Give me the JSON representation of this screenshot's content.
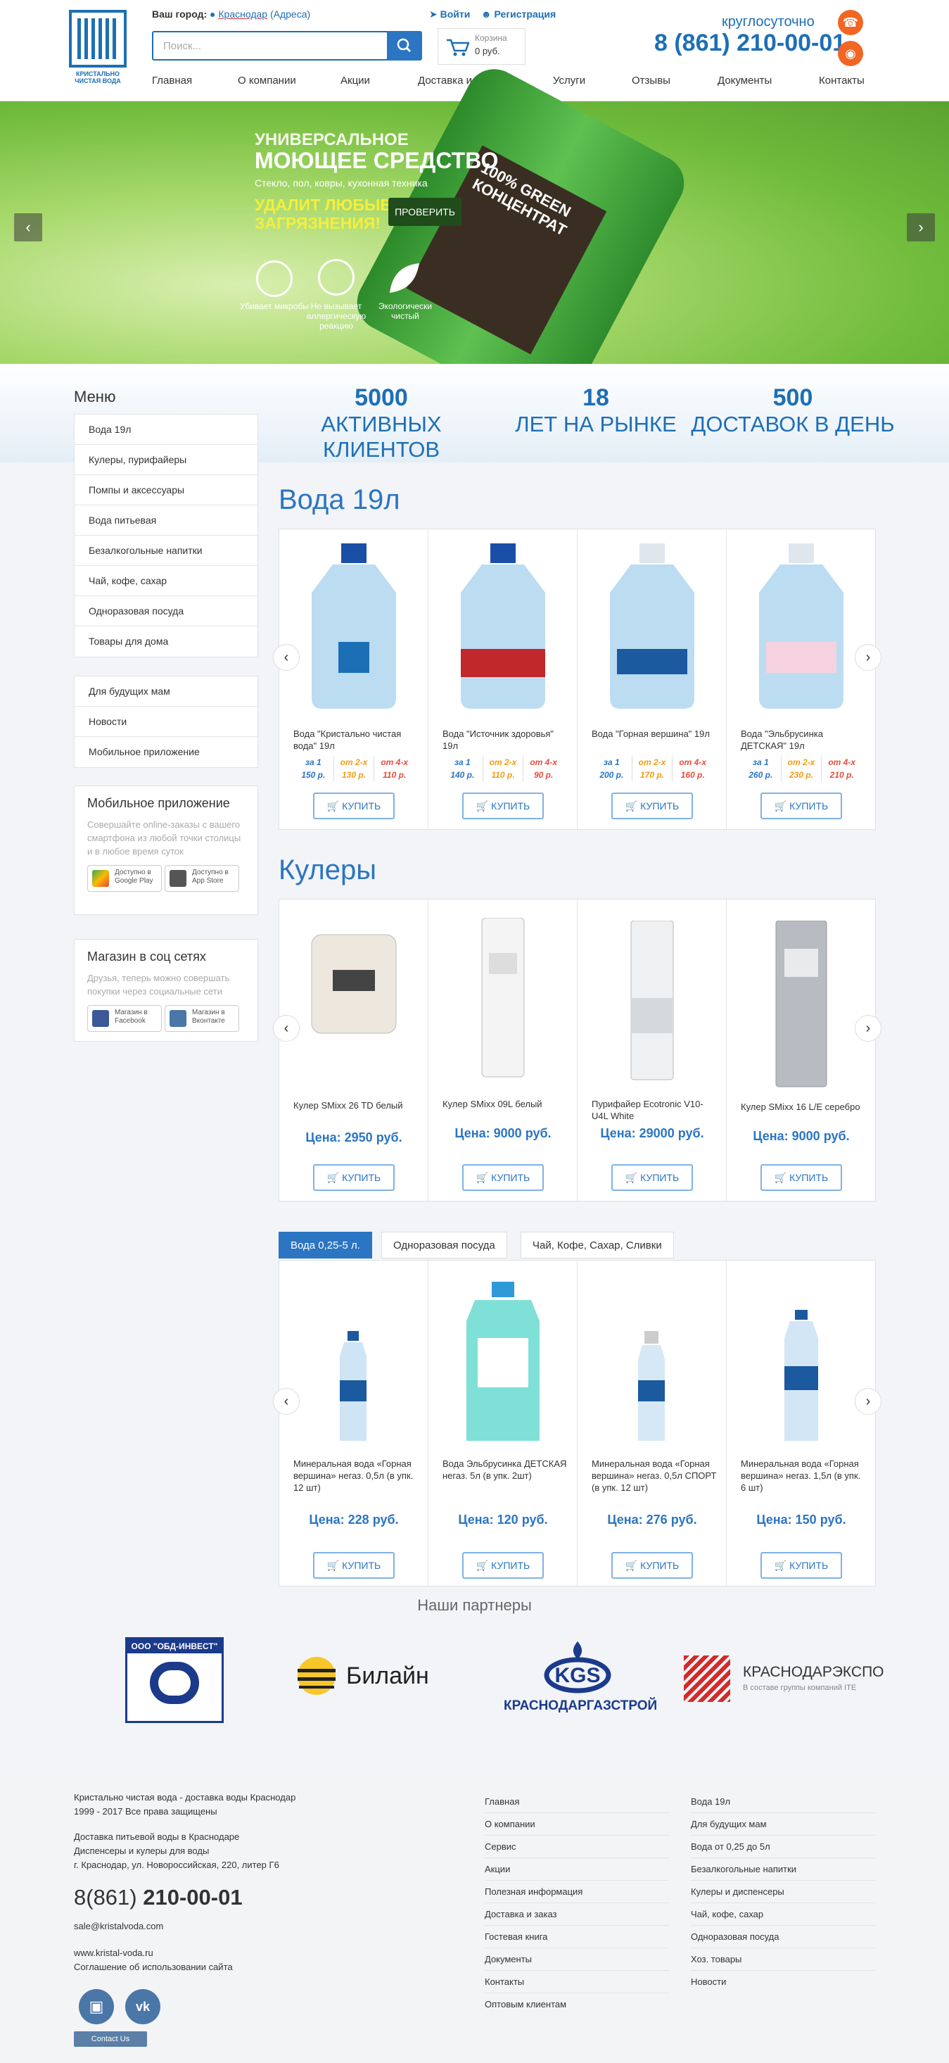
{
  "header": {
    "city_label": "Ваш город:",
    "city": "Краснодар",
    "city_addr": "(Адреса)",
    "search_placeholder": "Поиск...",
    "login": "Войти",
    "register": "Регистрация",
    "cart_title": "Корзина",
    "cart_sum": "0 руб.",
    "around_clock": "круглосуточно",
    "phone": "8 (861) 210-00-01",
    "logo_text": "КРИСТАЛЬНО ЧИСТАЯ ВОДА",
    "nav": [
      "Главная",
      "О компании",
      "Акции",
      "Доставка и оплата",
      "Услуги",
      "Отзывы",
      "Документы",
      "Контакты"
    ]
  },
  "banner": {
    "small": "УНИВЕРСАЛЬНОЕ",
    "big": "МОЮЩЕЕ СРЕДСТВО",
    "sub": "Стекло, пол, ковры, кухонная техника",
    "yellow": "УДАЛИТ ЛЮБЫЕ ЗАГРЯЗНЕНИЯ!",
    "button": "ПРОВЕРИТЬ",
    "features": [
      "Убивает микробы",
      "Не вызывает аллергическую реакцию",
      "Экологически чистый"
    ],
    "bottle_text": "100% GREEN КОНЦЕНТРАТ"
  },
  "stats": [
    {
      "num": "5000",
      "label": "АКТИВНЫХ КЛИЕНТОВ"
    },
    {
      "num": "18",
      "label": "ЛЕТ НА РЫНКЕ"
    },
    {
      "num": "500",
      "label": "ДОСТАВОК В ДЕНЬ"
    }
  ],
  "menu": {
    "title": "Меню",
    "items": [
      "Вода 19л",
      "Кулеры, пурифайеры",
      "Помпы и аксессуары",
      "Вода питьевая",
      "Безалкогольные напитки",
      "Чай, кофе, сахар",
      "Одноразовая посуда",
      "Товары для дома"
    ],
    "items2": [
      "Для будущих мам",
      "Новости",
      "Мобильное приложение"
    ]
  },
  "mobile": {
    "title": "Мобильное приложение",
    "text": "Совершайте online-заказы с вашего смартфона из любой точки столицы и в любое время суток",
    "gp": "Доступно в Google Play",
    "as": "Доступно в App Store"
  },
  "social": {
    "title": "Магазин в соц сетях",
    "text": "Друзья, теперь можно совершать покупки через социальные сети",
    "fb": "Магазин в Facebook",
    "vk": "Магазин в Вконтакте"
  },
  "water": {
    "title": "Вода 19л",
    "buy": "КУПИТЬ",
    "products": [
      {
        "name": "Вода \"Кристально чистая вода\" 19л",
        "t": [
          "за 1",
          "от 2-х",
          "от 4-х"
        ],
        "p": [
          "150 р.",
          "130 р.",
          "110 р."
        ]
      },
      {
        "name": "Вода \"Источник здоровья\" 19л",
        "t": [
          "за 1",
          "от 2-х",
          "от 4-х"
        ],
        "p": [
          "140 р.",
          "110 р.",
          "90 р."
        ]
      },
      {
        "name": "Вода \"Горная вершина\" 19л",
        "t": [
          "за 1",
          "от 2-х",
          "от 4-х"
        ],
        "p": [
          "200 р.",
          "170 р.",
          "160 р."
        ]
      },
      {
        "name": "Вода \"Эльбрусинка ДЕТСКАЯ\" 19л",
        "t": [
          "за 1",
          "от 2-х",
          "от 4-х"
        ],
        "p": [
          "260 р.",
          "230 р.",
          "210 р."
        ]
      }
    ]
  },
  "coolers": {
    "title": "Кулеры",
    "buy": "КУПИТЬ",
    "products": [
      {
        "name": "Кулер SMixx 26 TD белый",
        "price": "Цена: 2950 руб."
      },
      {
        "name": "Кулер SMixx 09L белый",
        "price": "Цена: 9000 руб."
      },
      {
        "name": "Пурифайер Ecotronic V10-U4L White",
        "price": "Цена: 29000 руб."
      },
      {
        "name": "Кулер SMixx 16 L/E серебро",
        "price": "Цена: 9000 руб."
      }
    ]
  },
  "tabs": [
    "Вода 0,25-5 л.",
    "Одноразовая посуда",
    "Чай, Кофе, Сахар, Сливки"
  ],
  "small_water": {
    "buy": "КУПИТЬ",
    "products": [
      {
        "name": "Минеральная вода «Горная вершина» негаз. 0,5л (в упк. 12 шт)",
        "price": "Цена: 228 руб."
      },
      {
        "name": "Вода Эльбрусинка ДЕТСКАЯ негаз. 5л (в упк. 2шт)",
        "price": "Цена: 120 руб."
      },
      {
        "name": "Минеральная вода «Горная вершина» негаз. 0,5л СПОРТ (в упк. 12 шт)",
        "price": "Цена: 276 руб."
      },
      {
        "name": "Минеральная вода «Горная вершина» негаз. 1,5л (в упк. 6 шт)",
        "price": "Цена: 150 руб."
      }
    ]
  },
  "partners": {
    "title": "Наши партнеры",
    "names": [
      "ООО \"ОБД-ИНВЕСТ\"",
      "Билайн",
      "КРАСНОДАРГАЗСТРОЙ",
      "КРАСНОДАРЭКСПО",
      "В составе группы компаний ITE"
    ]
  },
  "footer": {
    "l1": "Кристально чистая вода - доставка воды Краснодар",
    "l2": "1999 - 2017 Все права защищены",
    "l3": "Доставка питьевой воды в Краснодаре",
    "l4": "Диспенсеры и кулеры для воды",
    "l5": "г. Краснодар, ул. Новороссийская, 220, литер Г6",
    "phone_prefix": "8(861) ",
    "phone_main": "210-00-01",
    "email": "sale@kristalvoda.com",
    "site": "www.kristal-voda.ru",
    "terms": "Соглашение об использовании сайта",
    "vk_btn": "Contact Us",
    "col1": [
      "Главная",
      "О компании",
      "Сервис",
      "Акции",
      "Полезная информация",
      "Доставка и заказ",
      "Гостевая книга",
      "Документы",
      "Контакты",
      "Оптовым клиентам"
    ],
    "col2": [
      "Вода 19л",
      "Для будущих мам",
      "Вода от 0,25 до 5л",
      "Безалкогольные напитки",
      "Кулеры и диспенсеры",
      "Чай, кофе, сахар",
      "Одноразовая посуда",
      "Хоз. товары",
      "Новости"
    ]
  },
  "colors": {
    "brand": "#2b75c2",
    "orange": "#f26522",
    "tier1": "#2b75c2",
    "tier2": "#f39c12",
    "tier3": "#e74c3c"
  }
}
